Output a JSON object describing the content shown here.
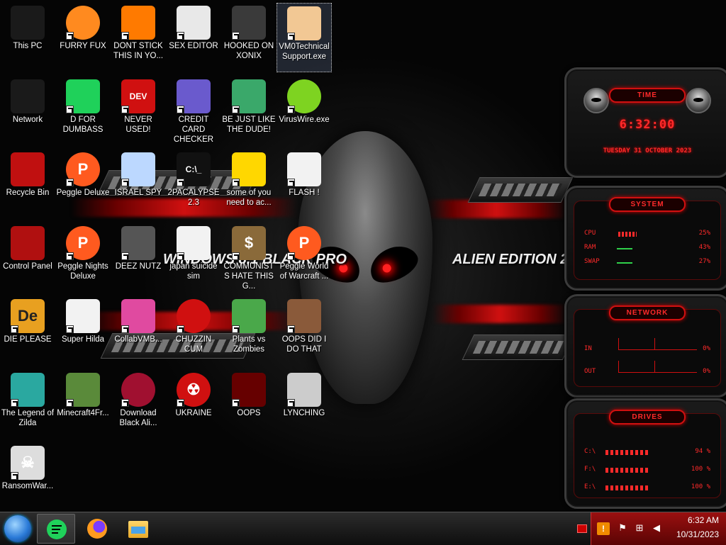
{
  "wallpaper": {
    "left_text": "WINDOWS 8.1 BLACK PRO",
    "right_text": "ALIEN EDITION 20"
  },
  "desktop_icons": [
    {
      "label": "This PC",
      "icon": "monitor-icon"
    },
    {
      "label": "FURRY FUX",
      "icon": "firefox-icon"
    },
    {
      "label": "DONT STICK THIS IN YO...",
      "icon": "vlc-cone-icon"
    },
    {
      "label": "SEX EDITOR",
      "icon": "hxd-editor-icon"
    },
    {
      "label": "HOOKED ON XONIX",
      "icon": "xonix-game-icon"
    },
    {
      "label": "VM0TechnicalSupport.exe",
      "icon": "tech-support-person-icon"
    },
    {
      "label": "Network",
      "icon": "network-icon"
    },
    {
      "label": "D FOR DUMBASS",
      "icon": "green-chat-icon"
    },
    {
      "label": "NEVER USED!",
      "icon": "dev-cpp-icon"
    },
    {
      "label": "CREDIT CARD CHECKER",
      "icon": "credit-card-icon"
    },
    {
      "label": "BE JUST LIKE THE DUDE!",
      "icon": "elf-character-icon"
    },
    {
      "label": "VirusWire.exe",
      "icon": "lime-wire-icon"
    },
    {
      "label": "Recycle Bin",
      "icon": "recycle-bin-icon"
    },
    {
      "label": "Peggle Deluxe",
      "icon": "peggle-icon"
    },
    {
      "label": "ISRAEL SPY",
      "icon": "spy-camera-icon"
    },
    {
      "label": "2PACALYPSE 2.3",
      "icon": "terminal-icon"
    },
    {
      "label": "some of you need to ac...",
      "icon": "beaver-image-icon"
    },
    {
      "label": "FLASH !",
      "icon": "flash-file-icon"
    },
    {
      "label": "Control Panel",
      "icon": "control-panel-icon"
    },
    {
      "label": "Peggle Nights Deluxe",
      "icon": "peggle-icon"
    },
    {
      "label": "DEEZ NUTZ",
      "icon": "window-stack-icon"
    },
    {
      "label": "japan suicide sim",
      "icon": "document-icon"
    },
    {
      "label": "COMMUNISTS HATE THIS G...",
      "icon": "money-bag-icon"
    },
    {
      "label": "Peggle World of Warcraft ...",
      "icon": "peggle-icon"
    },
    {
      "label": "DIE PLEASE",
      "icon": "de-app-icon"
    },
    {
      "label": "Super Hilda",
      "icon": "pixel-dog-icon"
    },
    {
      "label": "CollabVMB...",
      "icon": "pink-window-icon"
    },
    {
      "label": "CHUZZIN CUM",
      "icon": "chuzzle-icon"
    },
    {
      "label": "Plants vs Zombies",
      "icon": "plants-vs-zombies-icon"
    },
    {
      "label": "OOPS DID I DO THAT",
      "icon": "portrait-icon"
    },
    {
      "label": "The Legend of Zilda",
      "icon": "zelda-character-icon"
    },
    {
      "label": "Minecraft4Fr...",
      "icon": "minecraft-grass-icon"
    },
    {
      "label": "Download Black Ali...",
      "icon": "red-orb-icon"
    },
    {
      "label": "UKRAINE",
      "icon": "radiation-icon"
    },
    {
      "label": "OOPS",
      "icon": "red-laptop-icon"
    },
    {
      "label": "LYNCHING",
      "icon": "noose-icon"
    },
    {
      "label": "RansomWar...",
      "icon": "skull-ring-icon"
    }
  ],
  "gadgets": {
    "time": {
      "title": "TIME",
      "clock": "6:32:00",
      "date": "TUESDAY 31 OCTOBER 2023"
    },
    "system": {
      "title": "SYSTEM",
      "rows": [
        {
          "key": "CPU",
          "value": "25%"
        },
        {
          "key": "RAM",
          "value": "43%"
        },
        {
          "key": "SWAP",
          "value": "27%"
        }
      ]
    },
    "network": {
      "title": "NETWORK",
      "rows": [
        {
          "key": "IN",
          "value": "0%"
        },
        {
          "key": "OUT",
          "value": "0%"
        }
      ]
    },
    "drives": {
      "title": "DRIVES",
      "rows": [
        {
          "key": "C:\\",
          "value": "94 %"
        },
        {
          "key": "F:\\",
          "value": "100 %"
        },
        {
          "key": "E:\\",
          "value": "100 %"
        }
      ]
    }
  },
  "taskbar": {
    "apps": [
      {
        "name": "green-chat-app",
        "icon": "green-chat-icon",
        "active": true
      },
      {
        "name": "firefox-app",
        "icon": "firefox-icon",
        "active": false
      },
      {
        "name": "file-explorer-app",
        "icon": "folder-icon",
        "active": false
      }
    ],
    "tray": {
      "time": "6:32 AM",
      "date": "10/31/2023"
    }
  },
  "colors": {
    "accent_red": "#d01010",
    "gadget_text": "#ff2a2a",
    "tray_red": "#9a1010"
  }
}
